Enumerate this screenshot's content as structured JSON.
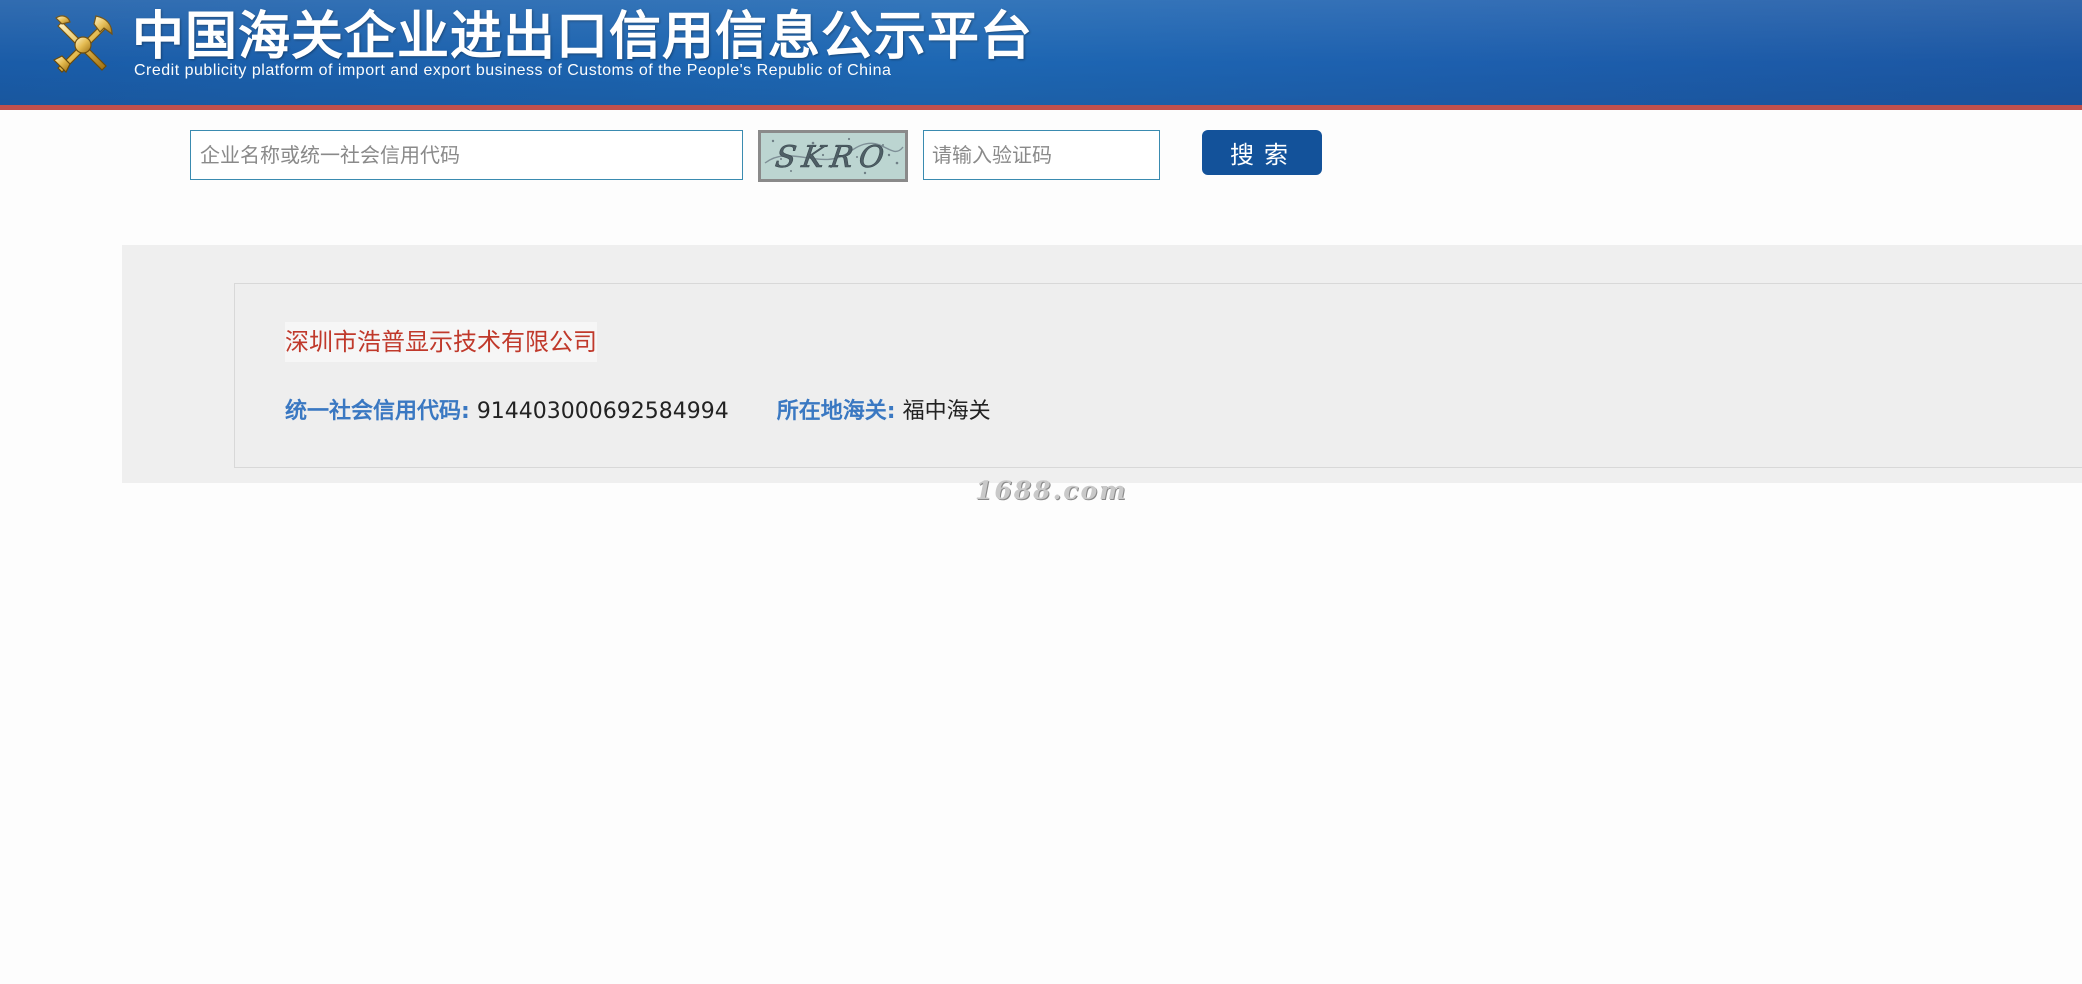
{
  "header": {
    "title": "中国海关企业进出口信用信息公示平台",
    "subtitle": "Credit publicity platform of import and export business of Customs of the People's Republic of China",
    "logo_icon": "customs-emblem-icon"
  },
  "search": {
    "company_placeholder": "企业名称或统一社会信用代码",
    "company_value": "",
    "captcha_text": "SKRO",
    "captcha_placeholder": "请输入验证码",
    "captcha_value": "",
    "button_label": "搜索"
  },
  "result": {
    "company_name": "深圳市浩普显示技术有限公司",
    "credit_code_label": "统一社会信用代码:",
    "credit_code_value": "914403000692584994",
    "customs_label": "所在地海关:",
    "customs_value": "福中海关"
  },
  "watermark": "1688.com",
  "colors": {
    "header_blue": "#1d67b3",
    "header_border": "#c0504d",
    "button_blue": "#13529a",
    "company_red": "#c0392b",
    "label_blue": "#3a78c2"
  }
}
